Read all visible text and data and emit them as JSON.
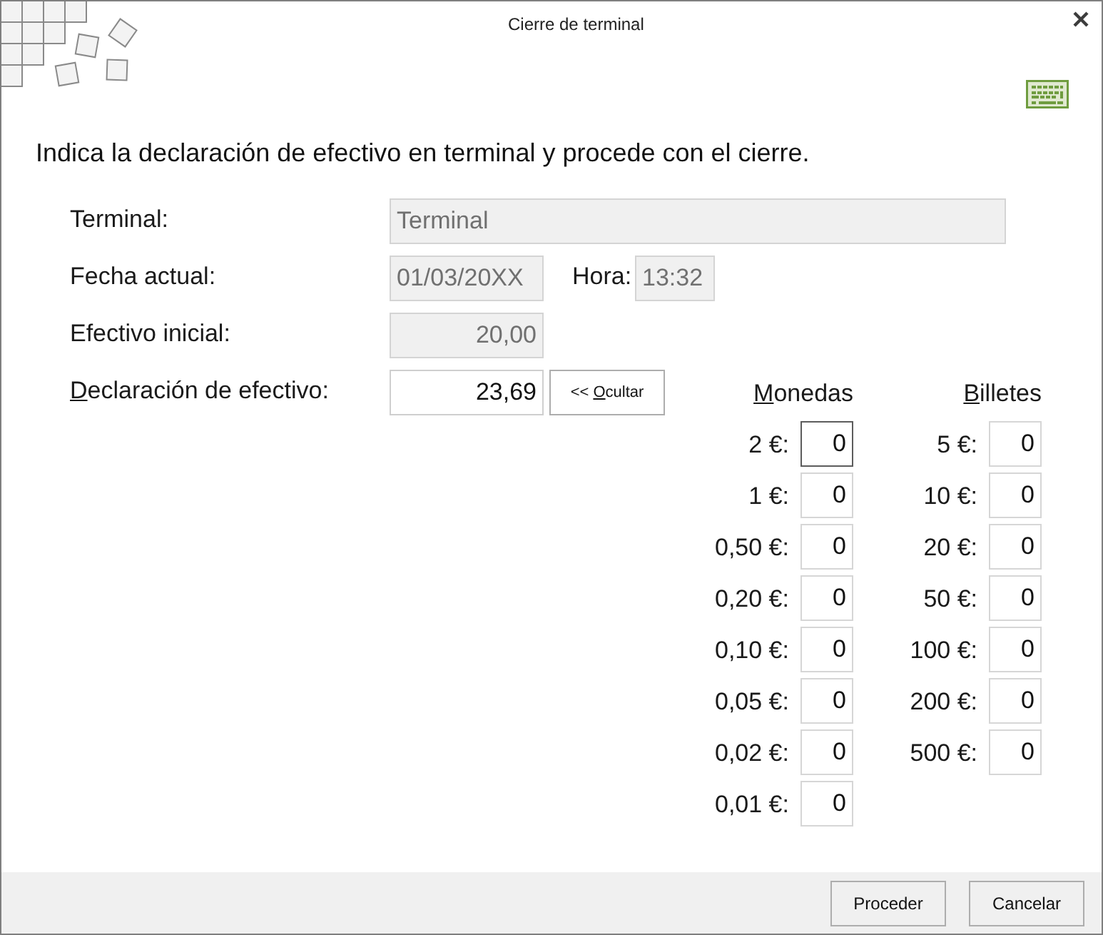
{
  "window": {
    "title": "Cierre de terminal"
  },
  "instruction": "Indica la declaración de efectivo en terminal y procede con el cierre.",
  "terminal": {
    "label": "Terminal:",
    "value": "Terminal",
    "disabled": true
  },
  "date": {
    "label": "Fecha actual:",
    "value": "01/03/20XX",
    "disabled": true
  },
  "time": {
    "label": "Hora:",
    "value": "13:32",
    "disabled": true
  },
  "initial_cash": {
    "label": "Efectivo inicial:",
    "value": "20,00",
    "disabled": true
  },
  "cash_declaration": {
    "label": "Declaración de efectivo:",
    "mnemonic": true,
    "value": "23,69",
    "disabled": false
  },
  "toggle_button": {
    "label": "<< Ocultar",
    "mnemonic": true
  },
  "coins": {
    "title": "Monedas",
    "mnemonic": true,
    "items": [
      {
        "label": "2 €:",
        "value": "0",
        "focused": true
      },
      {
        "label": "1 €:",
        "value": "0",
        "focused": false
      },
      {
        "label": "0,50 €:",
        "value": "0",
        "focused": false
      },
      {
        "label": "0,20 €:",
        "value": "0",
        "focused": false
      },
      {
        "label": "0,10 €:",
        "value": "0",
        "focused": false
      },
      {
        "label": "0,05 €:",
        "value": "0",
        "focused": false
      },
      {
        "label": "0,02 €:",
        "value": "0",
        "focused": false
      },
      {
        "label": "0,01 €:",
        "value": "0",
        "focused": false
      }
    ]
  },
  "bills": {
    "title": "Billetes",
    "mnemonic": true,
    "items": [
      {
        "label": "5 €:",
        "value": "0",
        "focused": false
      },
      {
        "label": "10 €:",
        "value": "0",
        "focused": false
      },
      {
        "label": "20 €:",
        "value": "0",
        "focused": false
      },
      {
        "label": "50 €:",
        "value": "0",
        "focused": false
      },
      {
        "label": "100 €:",
        "value": "0",
        "focused": false
      },
      {
        "label": "200 €:",
        "value": "0",
        "focused": false
      },
      {
        "label": "500 €:",
        "value": "0",
        "focused": false
      }
    ]
  },
  "buttons": [
    {
      "label": "Proceder"
    },
    {
      "label": "Cancelar"
    }
  ]
}
